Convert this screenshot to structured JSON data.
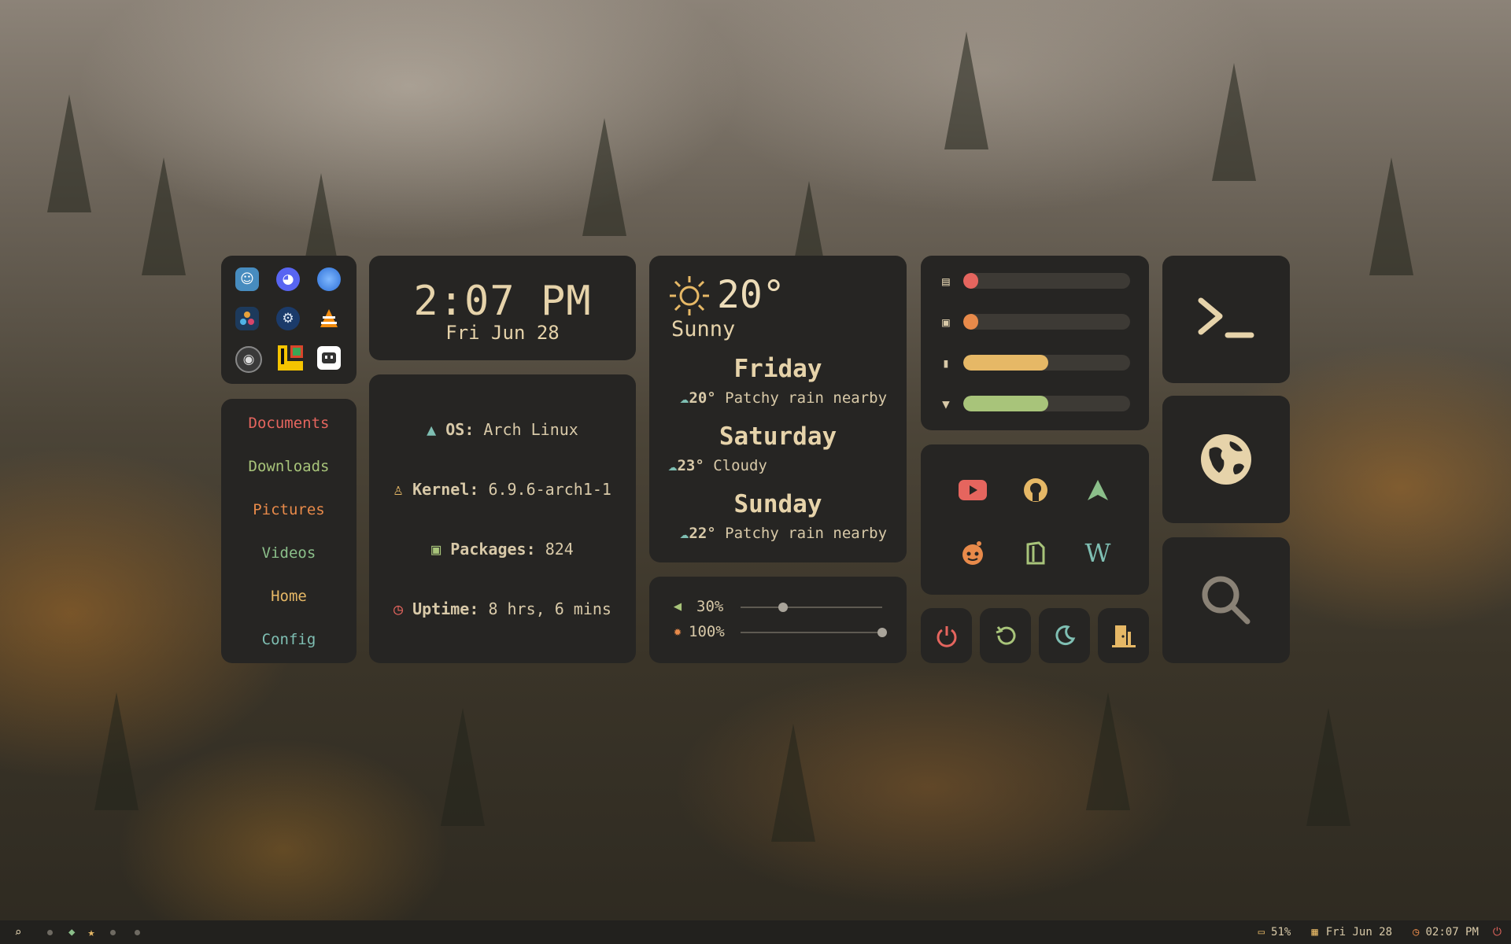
{
  "apps": [
    {
      "name": "Godot"
    },
    {
      "name": "Discord"
    },
    {
      "name": "Firefox"
    },
    {
      "name": "DaVinci Resolve"
    },
    {
      "name": "Steam"
    },
    {
      "name": "VLC"
    },
    {
      "name": "OBS"
    },
    {
      "name": "Lutris"
    },
    {
      "name": "Itch"
    }
  ],
  "clock": {
    "time": "2:07 PM",
    "date": "Fri Jun 28"
  },
  "folders": [
    {
      "label": "Documents",
      "color": "#e5655e"
    },
    {
      "label": "Downloads",
      "color": "#a8c47a"
    },
    {
      "label": "Pictures",
      "color": "#e88a4a"
    },
    {
      "label": "Videos",
      "color": "#8bbf8a"
    },
    {
      "label": "Home",
      "color": "#e6b866"
    },
    {
      "label": "Config",
      "color": "#7fbfb3"
    }
  ],
  "sysinfo": {
    "os_label": "OS:",
    "os_value": "Arch Linux",
    "kernel_label": "Kernel:",
    "kernel_value": "6.9.6-arch1-1",
    "packages_label": "Packages:",
    "packages_value": "824",
    "uptime_label": "Uptime:",
    "uptime_value": "8 hrs, 6 mins"
  },
  "weather": {
    "current_temp": "20°",
    "current_cond": "Sunny",
    "forecast": [
      {
        "day": "Friday",
        "temp": "20°",
        "cond": "Patchy rain nearby"
      },
      {
        "day": "Saturday",
        "temp": "23°",
        "cond": "Cloudy"
      },
      {
        "day": "Sunday",
        "temp": "22°",
        "cond": "Patchy rain nearby"
      }
    ]
  },
  "audio": {
    "volume": "30%",
    "volume_level": 0.3,
    "brightness": "100%",
    "brightness_level": 1.0
  },
  "stats": [
    {
      "name": "memory",
      "level": 0.06,
      "color": "#e5655e"
    },
    {
      "name": "cpu",
      "level": 0.04,
      "color": "#e88a4a"
    },
    {
      "name": "battery",
      "level": 0.51,
      "color": "#e6b866"
    },
    {
      "name": "wifi",
      "level": 0.51,
      "color": "#a8c47a"
    }
  ],
  "links": [
    "YouTube",
    "GitHub",
    "Arch Linux",
    "Reddit",
    "LibreOffice",
    "Wikipedia"
  ],
  "power": [
    "power",
    "restart",
    "sleep",
    "logout"
  ],
  "launchers": [
    "terminal",
    "browser",
    "search"
  ],
  "taskbar": {
    "battery": "51%",
    "date": "Fri Jun 28",
    "time": "02:07 PM"
  },
  "colors": {
    "card": "#262523",
    "text": "#d8c9a8",
    "accent": "#e6d3aa",
    "red": "#e5655e",
    "green": "#a8c47a",
    "orange": "#e88a4a",
    "yellow": "#e6b866",
    "teal": "#7fbfb3"
  }
}
